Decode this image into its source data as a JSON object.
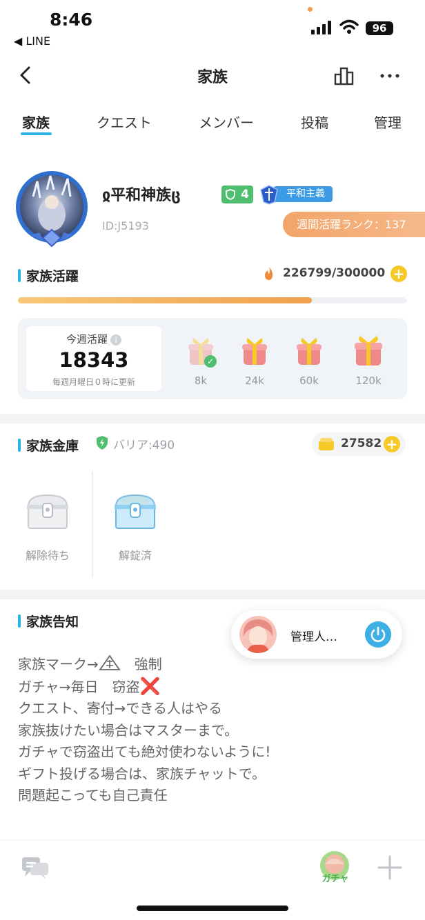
{
  "status_bar": {
    "time": "8:46",
    "back_app": "◀ LINE",
    "battery": "96"
  },
  "header": {
    "title": "家族"
  },
  "tabs": [
    {
      "label": "家族",
      "active": true
    },
    {
      "label": "クエスト"
    },
    {
      "label": "メンバー"
    },
    {
      "label": "投稿"
    },
    {
      "label": "管理"
    }
  ],
  "family": {
    "name": "ჲ平和神族ც",
    "level": "4",
    "policy": "平和主義",
    "id": "ID:J5193",
    "weekly_rank": "週間活躍ランク：137"
  },
  "activity": {
    "title": "家族活躍",
    "current": 226799,
    "goal": 300000,
    "display": "226799/300000",
    "progress_fraction": 0.756,
    "weekly_label": "今週活躍",
    "weekly_value": "18343",
    "weekly_note": "毎週月曜日０時に更新",
    "rewards": [
      {
        "label": "8k",
        "claimed": true
      },
      {
        "label": "24k",
        "claimed": false
      },
      {
        "label": "60k",
        "claimed": false
      },
      {
        "label": "120k",
        "claimed": false
      }
    ]
  },
  "vault": {
    "title": "家族金庫",
    "barrier": "バリア:490",
    "coins": "27582",
    "chests": [
      {
        "label": "解除待ち",
        "state": "locked"
      },
      {
        "label": "解錠済",
        "state": "unlocked"
      }
    ]
  },
  "notice": {
    "title": "家族告知",
    "lines": {
      "l1a": "家族マーク→",
      "l1b": "　強制",
      "l2a": "ガチャ→毎日　窃盗",
      "l2b": "❌",
      "l3": "クエスト、寄付→できる人はやる",
      "l4": "家族抜けたい場合はマスターまで。",
      "l5": "ガチャで窃盗出ても絶対使わないように!",
      "l6": "ギフト投げる場合は、家族チャットで。",
      "l7": "問題起こっても自己責任"
    }
  },
  "admin_float": {
    "name": "管理人…"
  },
  "bottom_bar": {
    "gacha_label": "ガチャ"
  },
  "colors": {
    "accent": "#29b6e6",
    "orange": "#f0a04b",
    "green": "#4fbf6f",
    "gold": "#f6c928"
  }
}
